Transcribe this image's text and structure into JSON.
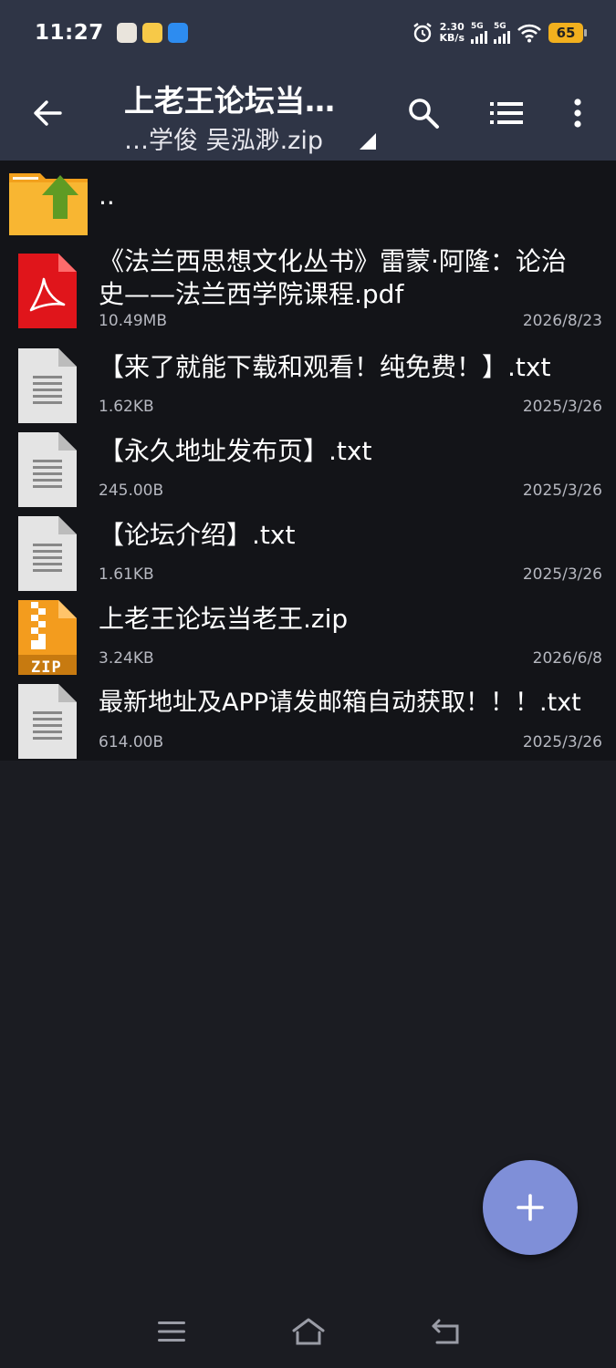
{
  "status_bar": {
    "time": "11:27",
    "net_speed_value": "2.30",
    "net_speed_unit": "KB/s",
    "sim1_label": "5G",
    "sim2_label": "5G",
    "battery": "65"
  },
  "app_bar": {
    "title": "上老王论坛当…",
    "subtitle": "…学俊 吴泓渺.zip"
  },
  "parent_entry": {
    "label": ".."
  },
  "files": [
    {
      "name_line1": "《法兰西思想文化丛书》雷蒙·阿隆：论治",
      "name_line2": "史——法兰西学院课程.pdf",
      "size": "10.49MB",
      "date": "2026/8/23",
      "icon": "pdf-file-icon"
    },
    {
      "name": "【来了就能下载和观看！纯免费！】.txt",
      "size": "1.62KB",
      "date": "2025/3/26",
      "icon": "text-file-icon"
    },
    {
      "name": "【永久地址发布页】.txt",
      "size": "245.00B",
      "date": "2025/3/26",
      "icon": "text-file-icon"
    },
    {
      "name": "【论坛介绍】.txt",
      "size": "1.61KB",
      "date": "2025/3/26",
      "icon": "text-file-icon"
    },
    {
      "name": "上老王论坛当老王.zip",
      "size": "3.24KB",
      "date": "2026/6/8",
      "icon": "zip-file-icon",
      "badge": "ZIP"
    },
    {
      "name": "最新地址及APP请发邮箱自动获取！！！.txt",
      "size": "614.00B",
      "date": "2025/3/26",
      "icon": "text-file-icon"
    }
  ],
  "colors": {
    "app_bar": "#2f3546",
    "background": "#1b1c22",
    "fab": "#7f8fd8",
    "pdf": "#e0151b",
    "zip": "#f39c1e",
    "folder": "#f5a623"
  }
}
